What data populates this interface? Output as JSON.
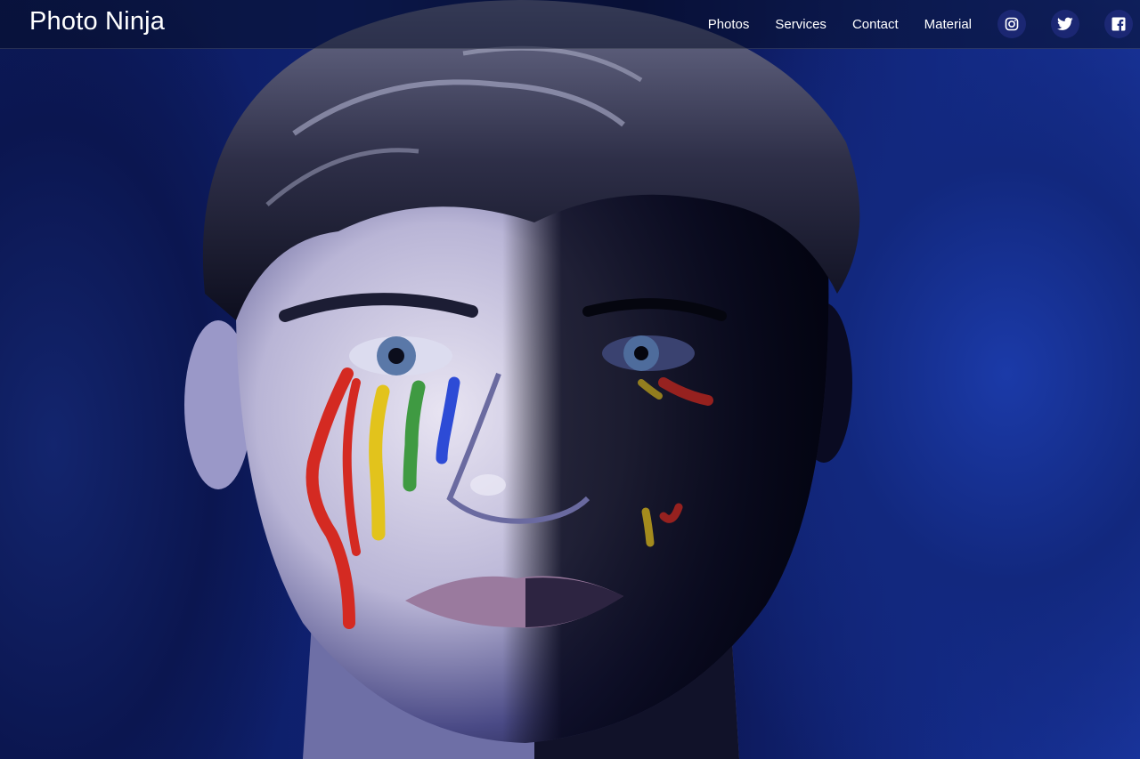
{
  "brand": {
    "name": "Photo Ninja"
  },
  "nav": {
    "items": [
      {
        "label": "Photos"
      },
      {
        "label": "Services"
      },
      {
        "label": "Contact"
      },
      {
        "label": "Material"
      }
    ],
    "social": [
      {
        "icon": "instagram-icon"
      },
      {
        "icon": "twitter-icon"
      },
      {
        "icon": "facebook-icon"
      }
    ]
  },
  "colors": {
    "background_blue": "#12287e",
    "nav_text": "#ffffff",
    "paint_red": "#d42a22",
    "paint_yellow": "#e2c31c",
    "paint_green": "#3f9a42",
    "paint_blue": "#2d4bd6"
  }
}
